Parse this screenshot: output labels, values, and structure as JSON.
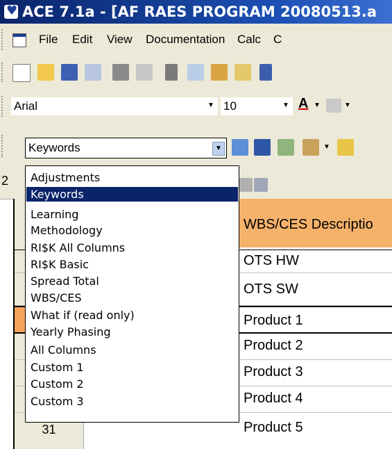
{
  "window": {
    "title": "ACE 7.1a - [AF RAES PROGRAM 20080513.a"
  },
  "menu": {
    "items": [
      "File",
      "Edit",
      "View",
      "Documentation",
      "Calc",
      "C"
    ]
  },
  "font": {
    "family": "Arial",
    "size": "10"
  },
  "view_selector": {
    "selected": "Keywords",
    "options": [
      "Adjustments",
      "Keywords",
      "Learning",
      "Methodology",
      "RI$K All Columns",
      "RI$K Basic",
      "Spread Total",
      "WBS/CES",
      "What if (read only)",
      "Yearly Phasing",
      "All Columns",
      "Custom 1",
      "Custom 2",
      "Custom 3"
    ]
  },
  "grid": {
    "header_partial_text": "2",
    "column_header": "WBS/CES Descriptio",
    "rows": [
      {
        "num": "",
        "desc": "OTS HW"
      },
      {
        "num": "",
        "desc": "OTS SW"
      },
      {
        "num": "",
        "desc": "Product 1"
      },
      {
        "num": "",
        "desc": "Product 2"
      },
      {
        "num": "",
        "desc": "Product 3"
      },
      {
        "num": "",
        "desc": "Product 4"
      },
      {
        "num": "31",
        "desc": "Product 5"
      }
    ]
  },
  "colors": {
    "titlebar": "#0a246a",
    "selection": "#0a246a",
    "header_cell": "#f6b26b",
    "toolbar": "#ece9d8"
  }
}
